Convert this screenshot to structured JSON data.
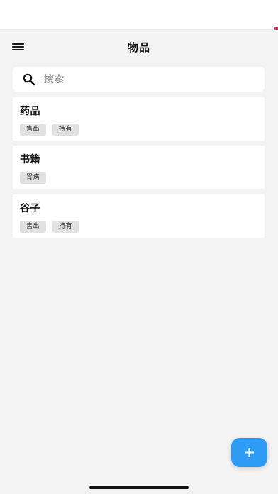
{
  "header": {
    "title": "物品",
    "menu_icon": "hamburger-menu-icon"
  },
  "search": {
    "placeholder": "搜索",
    "value": "",
    "icon": "search-icon"
  },
  "items": [
    {
      "title": "药品",
      "tags": [
        "售出",
        "持有"
      ]
    },
    {
      "title": "书籍",
      "tags": [
        "胃病"
      ]
    },
    {
      "title": "谷子",
      "tags": [
        "售出",
        "持有"
      ]
    }
  ],
  "fab": {
    "icon": "plus-icon",
    "color": "#2e9cf5"
  },
  "colors": {
    "background": "#f3f3f4",
    "card": "#ffffff",
    "tag": "#e1e1e1",
    "accent": "#2e9cf5"
  }
}
